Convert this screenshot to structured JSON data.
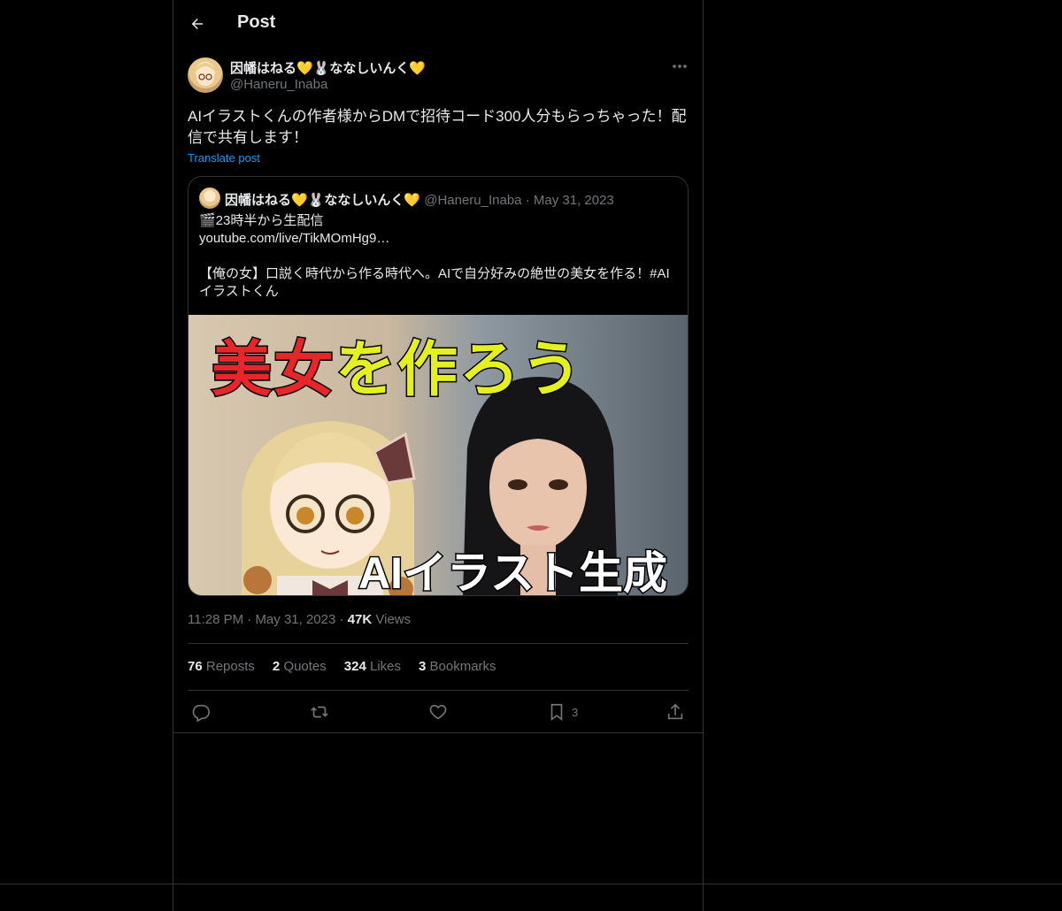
{
  "header": {
    "title": "Post"
  },
  "post": {
    "author_name": "因幡はねる💛🐰ななしいんく💛",
    "handle": "@Haneru_Inaba",
    "text": "AIイラストくんの作者様からDMで招待コード300人分もらっちゃった！配信で共有します！",
    "translate_label": "Translate post",
    "time": "11:28 PM",
    "date": "May 31, 2023",
    "views_count": "47K",
    "views_label": "Views"
  },
  "quote": {
    "author_name": "因幡はねる💛🐰ななしいんく💛",
    "handle": "@Haneru_Inaba",
    "date": "May 31, 2023",
    "line1": "🎬23時半から生配信",
    "line2": "youtube.com/live/TikMOmHg9…",
    "line3": "【俺の女】口説く時代から作る時代へ。AIで自分好みの絶世の美女を作る！#AIイラストくん",
    "image_title_red": "美女",
    "image_title_yellow_1": "を",
    "image_title_yellow_2": "作ろう",
    "image_subtitle": "AIイラスト生成"
  },
  "stats": {
    "reposts_count": "76",
    "reposts_label": "Reposts",
    "quotes_count": "2",
    "quotes_label": "Quotes",
    "likes_count": "324",
    "likes_label": "Likes",
    "bookmarks_count": "3",
    "bookmarks_label": "Bookmarks"
  },
  "actions": {
    "reply_icon": "reply-icon",
    "repost_icon": "repost-icon",
    "like_icon": "heart-icon",
    "bookmark_icon": "bookmark-icon",
    "bookmark_count": "3",
    "share_icon": "share-icon"
  },
  "colors": {
    "background": "#000000",
    "text": "#e7e9ea",
    "muted": "#71767b",
    "link": "#1d9bf0",
    "border": "#2f3336"
  }
}
